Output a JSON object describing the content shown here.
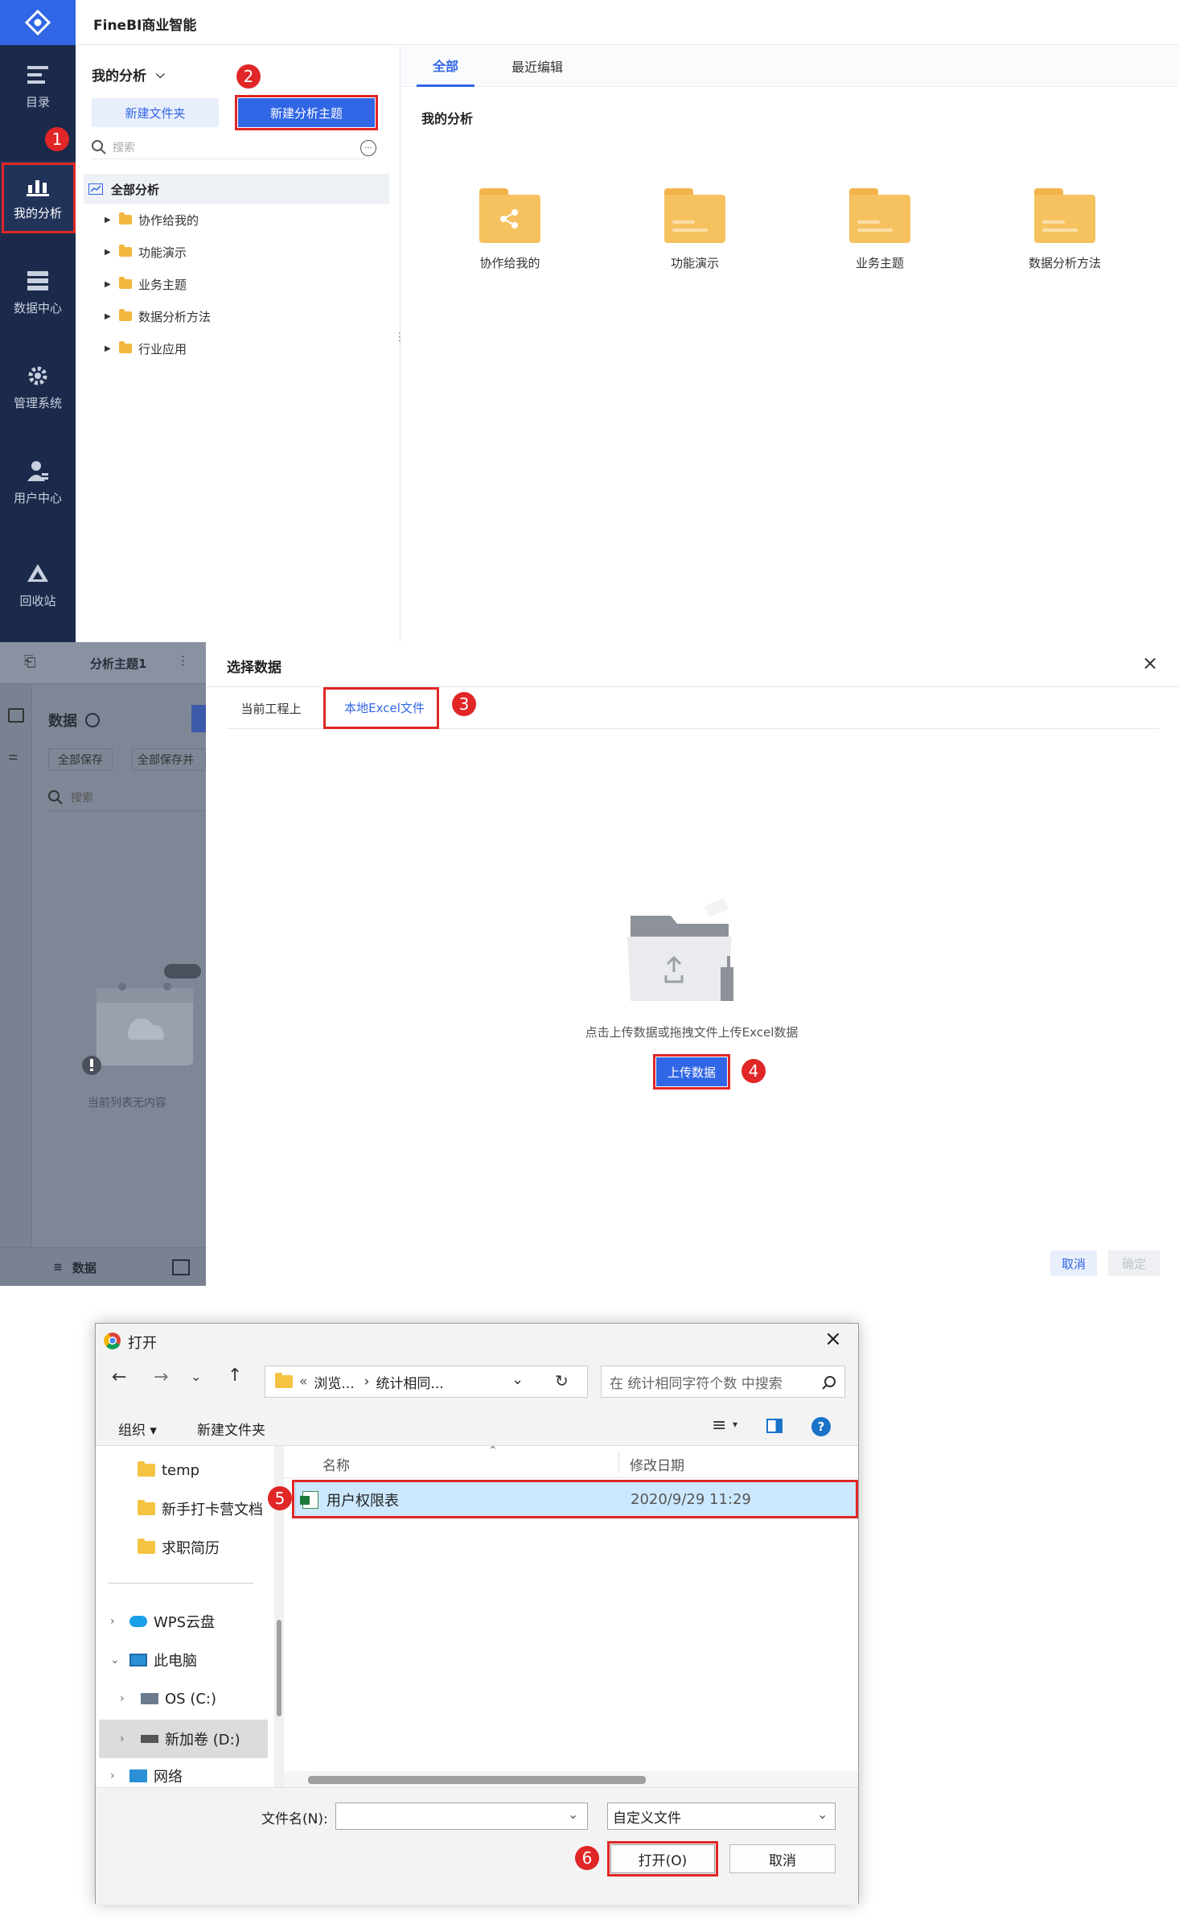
{
  "panel1": {
    "app_title": "FineBI商业智能",
    "nav": [
      {
        "label": "目录",
        "icon": "catalog-icon"
      },
      {
        "label": "我的分析",
        "icon": "analysis-chart-icon"
      },
      {
        "label": "数据中心",
        "icon": "data-center-icon"
      },
      {
        "label": "管理系统",
        "icon": "management-gear-icon"
      },
      {
        "label": "用户中心",
        "icon": "user-icon"
      },
      {
        "label": "回收站",
        "icon": "recycle-icon"
      }
    ],
    "tree_title": "我的分析",
    "new_folder_label": "新建文件夹",
    "new_subject_label": "新建分析主题",
    "search_placeholder": "搜索",
    "tree_root": "全部分析",
    "tree_items": [
      "协作给我的",
      "功能演示",
      "业务主题",
      "数据分析方法",
      "行业应用"
    ],
    "tabs": [
      "全部",
      "最近编辑"
    ],
    "section_title": "我的分析",
    "folders": [
      "协作给我的",
      "功能演示",
      "业务主题",
      "数据分析方法"
    ]
  },
  "panel2": {
    "subject_name": "分析主题1",
    "data_label": "数据",
    "save_all_label": "全部保存",
    "save_all_update_label": "全部保存并",
    "search_placeholder": "搜索",
    "empty_text": "当前列表无内容",
    "bottom_tab": "数据",
    "dialog_title": "选择数据",
    "tab_current": "当前工程上",
    "tab_excel": "本地Excel文件",
    "upload_hint": "点击上传数据或拖拽文件上传Excel数据",
    "upload_button": "上传数据",
    "cancel_label": "取消",
    "confirm_label": "确定"
  },
  "panel3": {
    "window_title": "打开",
    "path_parts": [
      "«",
      "浏览...",
      "›",
      "统计相同..."
    ],
    "search_placeholder": "在 统计相同字符个数 中搜索",
    "organize_label": "组织 ▾",
    "new_folder_label": "新建文件夹",
    "sidebar": [
      "temp",
      "新手打卡营文档",
      "求职简历",
      "WPS云盘",
      "此电脑",
      "OS (C:)",
      "新加卷 (D:)",
      "网络"
    ],
    "col_name": "名称",
    "col_date": "修改日期",
    "file_name": "用户权限表",
    "file_date": "2020/9/29 11:29",
    "filename_label": "文件名(N):",
    "filetype_value": "自定义文件",
    "open_label": "打开(O)",
    "cancel_label": "取消"
  },
  "badges": [
    "1",
    "2",
    "3",
    "4",
    "5",
    "6"
  ],
  "colors": {
    "primary": "#3166e6",
    "sidebar": "#1b2a4a",
    "annotation": "#e02626",
    "folder": "#f6c260"
  }
}
